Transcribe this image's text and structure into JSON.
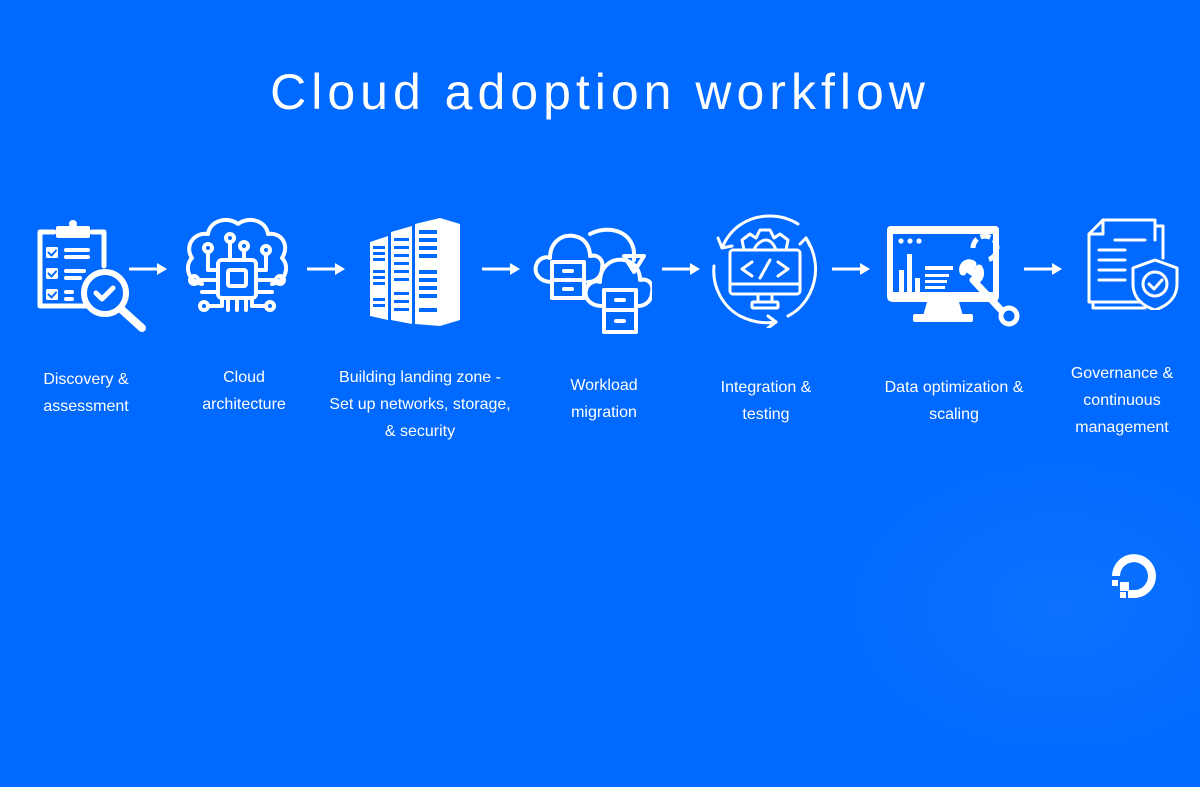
{
  "title": "Cloud adoption workflow",
  "colors": {
    "background": "#0069ff",
    "foreground": "#ffffff"
  },
  "steps": [
    {
      "icon": "clipboard-checklist-magnifier-icon",
      "label_lines": [
        "Discovery &",
        "assessment"
      ]
    },
    {
      "icon": "cloud-chip-circuit-icon",
      "label_lines": [
        "Cloud",
        "architecture"
      ]
    },
    {
      "icon": "server-racks-icon",
      "label_lines": [
        "Building landing zone -",
        "Set up networks, storage,",
        "& security"
      ]
    },
    {
      "icon": "cloud-migration-icon",
      "label_lines": [
        "Workload",
        "migration"
      ]
    },
    {
      "icon": "code-monitor-gear-cycle-icon",
      "label_lines": [
        "Integration &",
        "testing"
      ]
    },
    {
      "icon": "dashboard-monitor-wrench-icon",
      "label_lines": [
        "Data optimization &",
        "scaling"
      ]
    },
    {
      "icon": "document-shield-check-icon",
      "label_lines": [
        "Governance &",
        "continuous",
        "management"
      ]
    }
  ],
  "connector": "arrow-right-icon",
  "brand_logo": "digitalocean-logo-icon"
}
